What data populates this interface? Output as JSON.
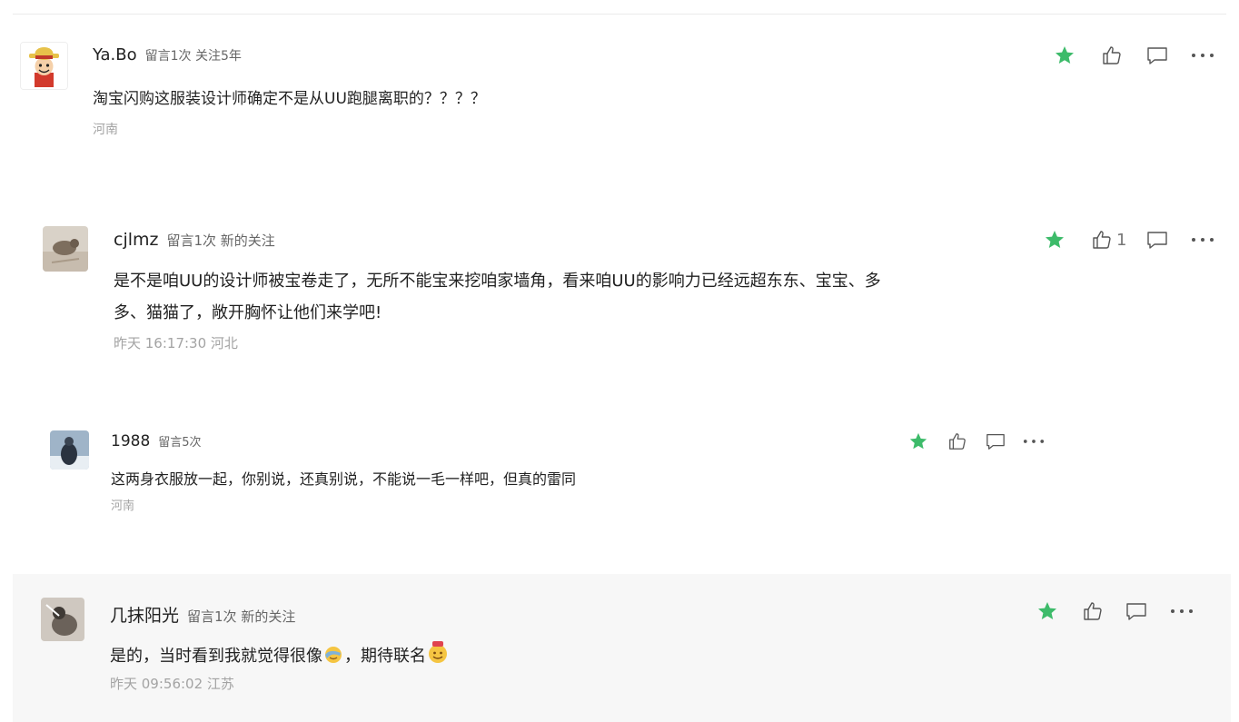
{
  "comments": [
    {
      "name": "Ya.Bo",
      "meta": "留言1次 关注5年",
      "text": "淘宝闪购这服装设计师确定不是从UU跑腿离职的？？？？",
      "sub": "河南",
      "like_count": ""
    },
    {
      "name": "cjlmz",
      "meta": "留言1次 新的关注",
      "text_line1": "是不是咱UU的设计师被宝卷走了，无所不能宝来挖咱家墙角，看来咱UU的影响力已经远超东东、宝宝、多",
      "text_line2": "多、猫猫了，敞开胸怀让他们来学吧!",
      "sub": "昨天 16:17:30 河北",
      "like_count": "1"
    },
    {
      "name": "1988",
      "meta": "留言5次",
      "text": "这两身衣服放一起，你别说，还真别说，不能说一毛一样吧，但真的雷同",
      "sub": "河南",
      "like_count": ""
    },
    {
      "name": "几抹阳光",
      "meta": "留言1次 新的关注",
      "text_a": "是的，当时看到我就觉得很像",
      "text_b": "，期待联名",
      "sub": "昨天 09:56:02 江苏",
      "like_count": ""
    }
  ],
  "icons": {
    "star": "star-icon",
    "like": "thumbs-up-icon",
    "reply": "speech-bubble-icon",
    "more": "more-dots-icon"
  },
  "colors": {
    "star": "#3dbb6a",
    "icon": "#555555",
    "meta_gray": "#a3a3a3",
    "highlight_bg": "#f7f7f7"
  }
}
